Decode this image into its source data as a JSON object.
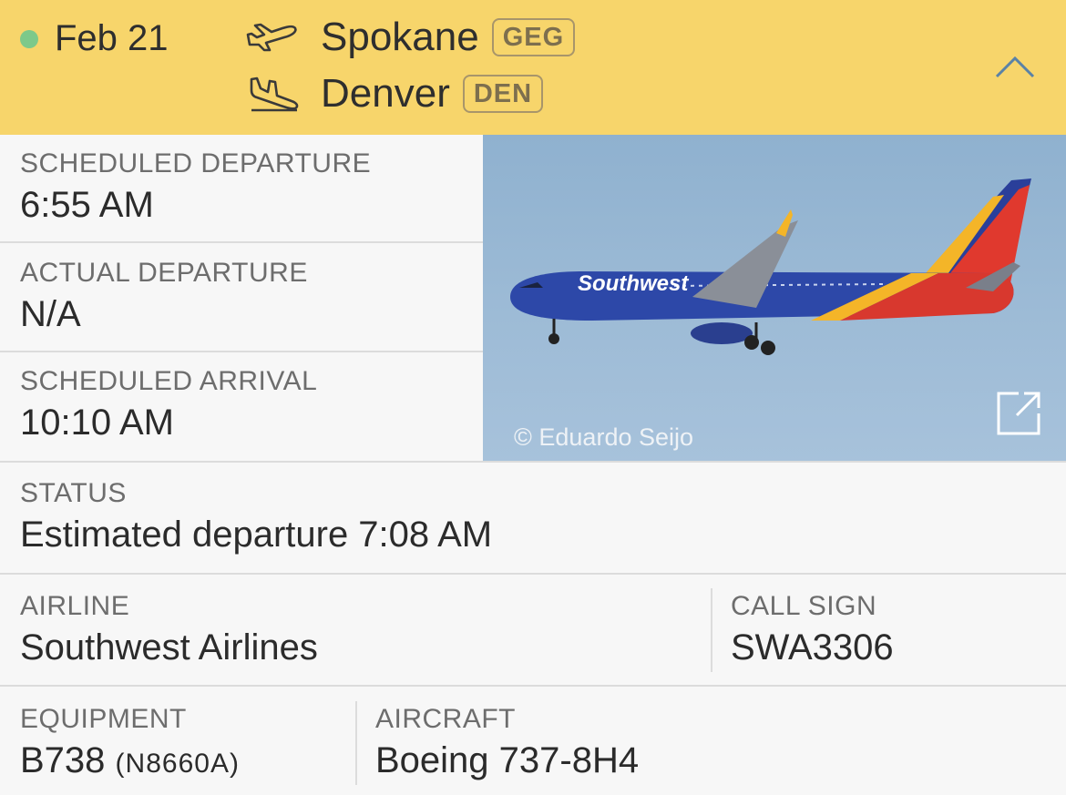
{
  "header": {
    "date": "Feb 21",
    "departure": {
      "city": "Spokane",
      "code": "GEG"
    },
    "arrival": {
      "city": "Denver",
      "code": "DEN"
    },
    "status_color": "#7dc98a",
    "background": "#f7d56b",
    "icons": [
      "takeoff-icon",
      "landing-icon",
      "chevron-up-icon"
    ]
  },
  "times": {
    "scheduled_departure": {
      "label": "SCHEDULED DEPARTURE",
      "value": "6:55 AM"
    },
    "actual_departure": {
      "label": "ACTUAL DEPARTURE",
      "value": "N/A"
    },
    "scheduled_arrival": {
      "label": "SCHEDULED ARRIVAL",
      "value": "10:10 AM"
    }
  },
  "photo": {
    "credit": "© Eduardo Seijo",
    "livery_text": "Southwest",
    "icon": "external-link-icon"
  },
  "status": {
    "label": "STATUS",
    "value": "Estimated departure 7:08 AM"
  },
  "airline": {
    "label": "AIRLINE",
    "value": "Southwest Airlines"
  },
  "call_sign": {
    "label": "CALL SIGN",
    "value": "SWA3306"
  },
  "equipment": {
    "label": "EQUIPMENT",
    "value": "B738",
    "registration": "(N8660A)"
  },
  "aircraft": {
    "label": "AIRCRAFT",
    "value": "Boeing 737-8H4"
  }
}
